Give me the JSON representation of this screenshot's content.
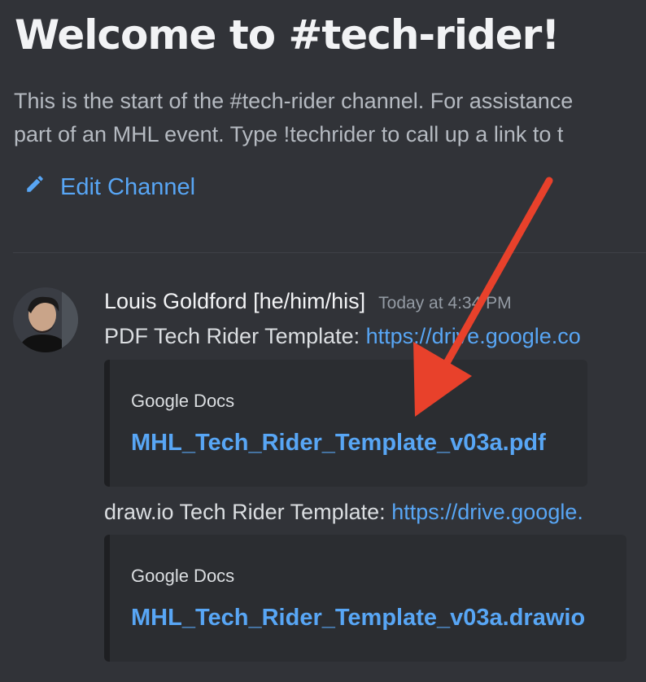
{
  "channel": {
    "welcome_title": "Welcome to #tech-rider!",
    "description_line1": "This is the start of the #tech-rider channel. For assistance",
    "description_line2": "part of an MHL event. Type !techrider to call up a link to t",
    "edit_label": "Edit Channel",
    "edit_icon": "pencil-icon"
  },
  "message": {
    "author": "Louis Goldford [he/him/his]",
    "timestamp": "Today at 4:34 PM",
    "avatar_icon": "user-avatar",
    "line1_prefix": "PDF Tech Rider Template: ",
    "line1_link": "https://drive.google.co",
    "embed1": {
      "provider": "Google Docs",
      "title": "MHL_Tech_Rider_Template_v03a.pdf"
    },
    "line2_prefix": "draw.io Tech Rider Template: ",
    "line2_link": "https://drive.google.",
    "embed2": {
      "provider": "Google Docs",
      "title": "MHL_Tech_Rider_Template_v03a.drawio"
    }
  },
  "colors": {
    "background": "#313338",
    "link": "#58a6f5",
    "embed_bg": "#2b2d31",
    "annotation_arrow": "#e8412b"
  }
}
